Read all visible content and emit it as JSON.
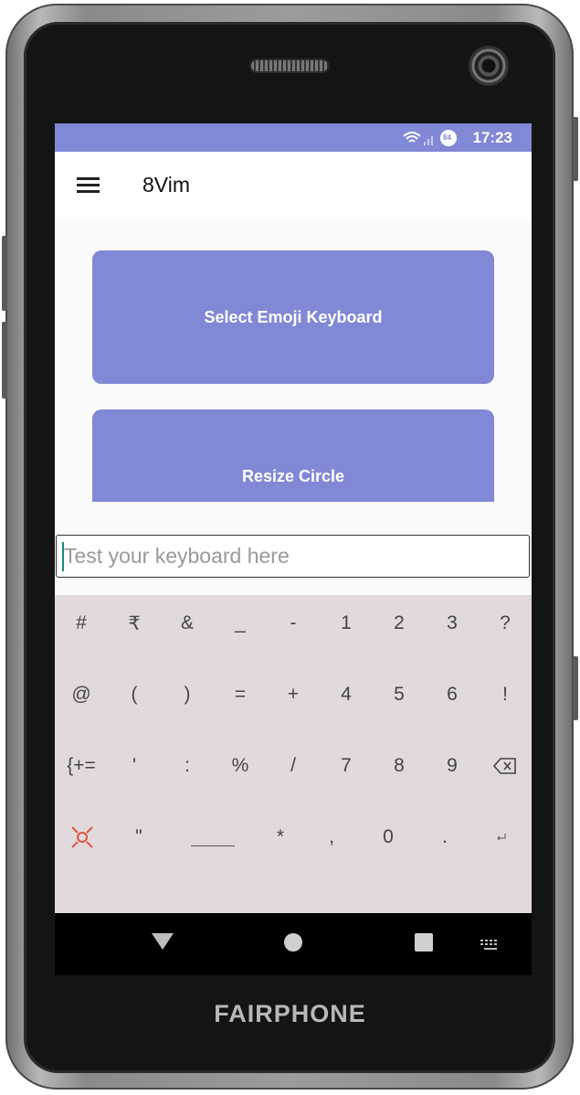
{
  "device": {
    "brand": "FAIRPHONE"
  },
  "status_bar": {
    "time": "17:23",
    "battery": "84"
  },
  "app_bar": {
    "title": "8Vim",
    "menu_icon": "hamburger-menu-icon"
  },
  "buttons": {
    "select_emoji": "Select Emoji Keyboard",
    "resize_circle": "Resize Circle"
  },
  "test_field": {
    "placeholder": "Test your keyboard here",
    "value": ""
  },
  "keyboard": {
    "rows": [
      [
        "#",
        "₹",
        "&",
        "_",
        "-",
        "1",
        "2",
        "3",
        "?"
      ],
      [
        "@",
        "(",
        ")",
        "=",
        "+",
        "4",
        "5",
        "6",
        "!"
      ],
      [
        "{+=",
        "'",
        ":",
        "%",
        "/",
        "7",
        "8",
        "9",
        "backspace-icon"
      ],
      [
        "8vim-switch-icon",
        "\"",
        "space",
        "*",
        ",",
        "0",
        ".",
        "enter-icon"
      ]
    ]
  },
  "colors": {
    "accent": "#8188d6",
    "keyboard_bg": "#e2d9dc",
    "switch_icon": "#e0543c"
  },
  "navbar": {
    "back": "back-triangle-icon",
    "home": "home-circle-icon",
    "recents": "recents-square-icon",
    "keyboard": "keyboard-icon"
  }
}
